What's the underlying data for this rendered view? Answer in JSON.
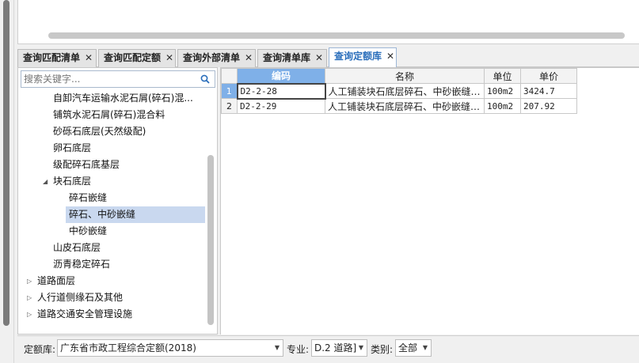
{
  "tabs": [
    {
      "label": "查询匹配清单",
      "active": false
    },
    {
      "label": "查询匹配定额",
      "active": false
    },
    {
      "label": "查询外部清单",
      "active": false
    },
    {
      "label": "查询清单库",
      "active": false
    },
    {
      "label": "查询定额库",
      "active": true
    }
  ],
  "tab_close_glyph": "✕",
  "search": {
    "placeholder": "搜索关键字..."
  },
  "tree": [
    {
      "label": "自卸汽车运输水泥石屑(碎石)混...",
      "level": 1,
      "expander": ""
    },
    {
      "label": "铺筑水泥石屑(碎石)混合料",
      "level": 1,
      "expander": ""
    },
    {
      "label": "砂砾石底层(天然级配)",
      "level": 1,
      "expander": ""
    },
    {
      "label": "卵石底层",
      "level": 1,
      "expander": ""
    },
    {
      "label": "级配碎石底基层",
      "level": 1,
      "expander": ""
    },
    {
      "label": "块石底层",
      "level": 1,
      "expander": "◢"
    },
    {
      "label": "碎石嵌缝",
      "level": 2,
      "expander": ""
    },
    {
      "label": "碎石、中砂嵌缝",
      "level": 2,
      "expander": "",
      "selected": true
    },
    {
      "label": "中砂嵌缝",
      "level": 2,
      "expander": ""
    },
    {
      "label": "山皮石底层",
      "level": 1,
      "expander": ""
    },
    {
      "label": "沥青稳定碎石",
      "level": 1,
      "expander": ""
    },
    {
      "label": "道路面层",
      "level": 0,
      "expander": "▷"
    },
    {
      "label": "人行道侧缘石及其他",
      "level": 0,
      "expander": "▷"
    },
    {
      "label": "道路交通安全管理设施",
      "level": 0,
      "expander": "▷"
    }
  ],
  "grid": {
    "columns": [
      "编码",
      "名称",
      "单位",
      "单价"
    ],
    "rows": [
      {
        "num": "1",
        "code": "D2-2-28",
        "name": "人工铺装块石底层碎石、中砂嵌缝…",
        "unit": "100m2",
        "price": "3424.7"
      },
      {
        "num": "2",
        "code": "D2-2-29",
        "name": "人工铺装块石底层碎石、中砂嵌缝…",
        "unit": "100m2",
        "price": "207.92"
      }
    ]
  },
  "bottom": {
    "quota_lib_label": "定额库:",
    "quota_lib_value": "广东省市政工程综合定额(2018)",
    "major_label": "专业:",
    "major_value": "D.2 道路]",
    "category_label": "类别:",
    "category_value": "全部"
  },
  "colors": {
    "accent": "#2a6ebb",
    "header_highlight": "#7fb0e8",
    "selected_row": "#c9d8ef"
  }
}
